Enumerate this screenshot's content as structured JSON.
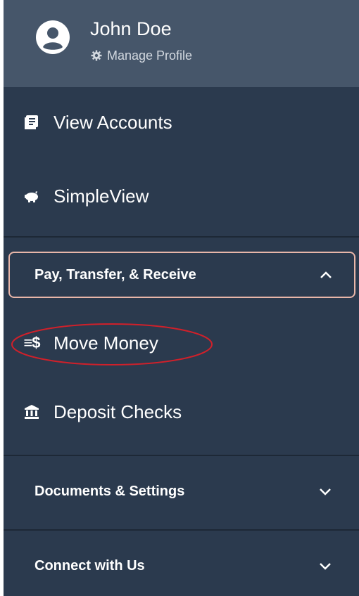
{
  "profile": {
    "name": "John Doe",
    "manage_label": "Manage Profile",
    "icons": {
      "avatar": "user-circle-icon",
      "manage": "gear-icon"
    }
  },
  "menu": {
    "view_accounts": {
      "label": "View Accounts",
      "icon": "ledger-icon"
    },
    "simpleview": {
      "label": "SimpleView",
      "icon": "piggy-bank-icon"
    }
  },
  "sections": {
    "pay_transfer": {
      "label": "Pay, Transfer, & Receive",
      "expanded": true,
      "items": {
        "move_money": {
          "label": "Move Money",
          "icon_text": "≡$"
        },
        "deposit_checks": {
          "label": "Deposit Checks",
          "icon": "bank-icon"
        }
      }
    },
    "documents_settings": {
      "label": "Documents & Settings",
      "expanded": false
    },
    "connect": {
      "label": "Connect with Us",
      "expanded": false
    }
  },
  "colors": {
    "nav_bg": "#2b3a4e",
    "profile_bg": "#46566a",
    "active_border": "#e8b6a9",
    "annotation": "#d0202a"
  }
}
